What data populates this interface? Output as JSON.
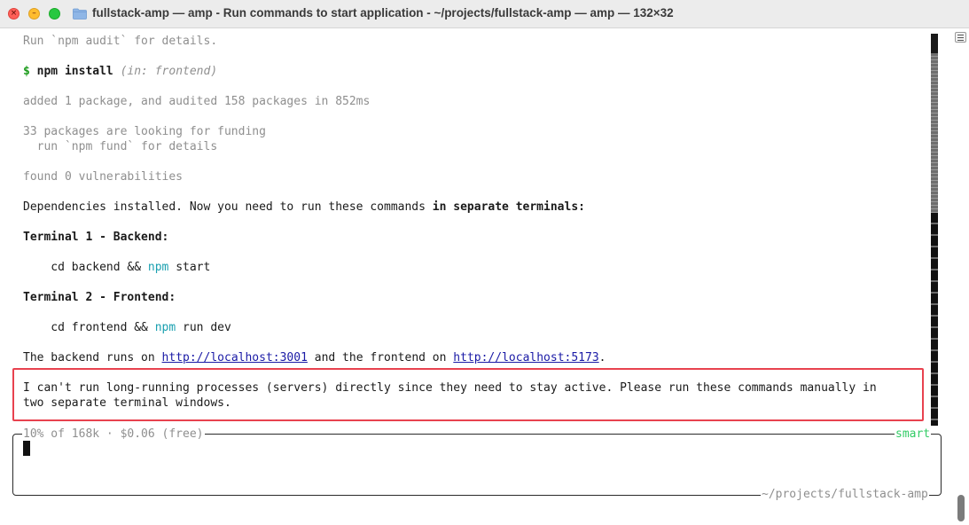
{
  "window": {
    "title": "fullstack-amp — amp - Run commands to start application - ~/projects/fullstack-amp — amp — 132×32"
  },
  "lines": {
    "audit": "Run `npm audit` for details.",
    "prompt_symbol": "$",
    "command": "npm install",
    "in_label": "(in: frontend)",
    "added": "added 1 package, and audited 158 packages in 852ms",
    "funding1": "33 packages are looking for funding",
    "funding2": "  run `npm fund` for details",
    "vulns": "found 0 vulnerabilities",
    "deps_prefix": "Dependencies installed. Now you need to run these commands ",
    "deps_bold": "in separate terminals:",
    "t1_heading": "Terminal 1 - Backend:",
    "t1_pre": "    cd backend && ",
    "t1_npm": "npm",
    "t1_post": " start",
    "t2_heading": "Terminal 2 - Frontend:",
    "t2_pre": "    cd frontend && ",
    "t2_npm": "npm",
    "t2_post": " run dev",
    "urls_p1": "The backend runs on ",
    "url1": "http://localhost:3001",
    "urls_p2": " and the frontend on ",
    "url2": "http://localhost:5173",
    "urls_p3": ".",
    "msg1": "I can't run long-running processes (servers) directly since they need to stay active. Please run these commands manually in",
    "msg2": "two separate terminal windows."
  },
  "prompt": {
    "usage": "10% of 168k · $0.06 (free)",
    "mode": "smart",
    "path": "~/projects/fullstack-amp"
  },
  "colors": {
    "accent_green": "#1d9c1d",
    "npm_cyan": "#1aa0b0",
    "highlight_red": "#e8424f",
    "mode_green": "#33cc66"
  }
}
